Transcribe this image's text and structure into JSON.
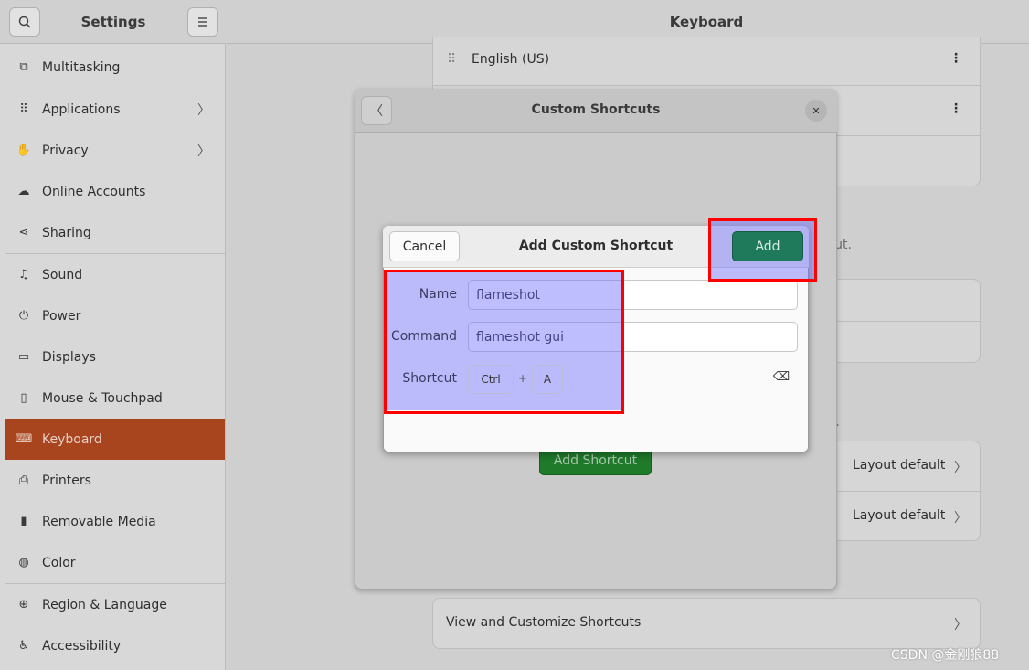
{
  "sidebar": {
    "title": "Settings",
    "search_icon": "search-icon",
    "menu_icon": "hamburger-icon",
    "items": [
      {
        "label": "Multitasking",
        "icon": "multitasking-icon",
        "glyph": "⧉"
      },
      {
        "label": "Applications",
        "icon": "apps-grid-icon",
        "glyph": "⠿",
        "chevron": "〉"
      },
      {
        "label": "Privacy",
        "icon": "hand-icon",
        "glyph": "✋",
        "chevron": "〉"
      },
      {
        "label": "Online Accounts",
        "icon": "cloud-icon",
        "glyph": "☁"
      },
      {
        "label": "Sharing",
        "icon": "share-icon",
        "glyph": "⋖"
      },
      {
        "label": "Sound",
        "icon": "music-note-icon",
        "glyph": "♫"
      },
      {
        "label": "Power",
        "icon": "power-icon",
        "glyph": "⏻"
      },
      {
        "label": "Displays",
        "icon": "display-icon",
        "glyph": "▭"
      },
      {
        "label": "Mouse & Touchpad",
        "icon": "mouse-icon",
        "glyph": "▯"
      },
      {
        "label": "Keyboard",
        "icon": "keyboard-icon",
        "glyph": "⌨"
      },
      {
        "label": "Printers",
        "icon": "printer-icon",
        "glyph": "⎙"
      },
      {
        "label": "Removable Media",
        "icon": "usb-drive-icon",
        "glyph": "▮"
      },
      {
        "label": "Color",
        "icon": "palette-icon",
        "glyph": "◍"
      },
      {
        "label": "Region & Language",
        "icon": "globe-icon",
        "glyph": "⊕"
      },
      {
        "label": "Accessibility",
        "icon": "accessibility-icon",
        "glyph": "♿"
      }
    ]
  },
  "main": {
    "title": "Keyboard",
    "input_source": "English (US)",
    "hint_1": "tcut.",
    "hint_2": "rd.",
    "layout_default_1": "Layout default",
    "layout_default_2": "Layout default",
    "view_customize": "View and Customize Shortcuts",
    "chevron": "〉",
    "more_icon": "⋮"
  },
  "custom_shortcuts": {
    "title": "Custom Shortcuts",
    "back_glyph": "〈",
    "close_glyph": "✕",
    "add_shortcut_label": "Add Shortcut"
  },
  "add_dialog": {
    "title": "Add Custom Shortcut",
    "cancel_label": "Cancel",
    "add_label": "Add",
    "name_label": "Name",
    "name_value": "flameshot",
    "command_label": "Command",
    "command_value": "flameshot gui",
    "shortcut_label": "Shortcut",
    "key_1": "Ctrl",
    "plus": "+",
    "key_2": "A",
    "clear_glyph": "⌫"
  },
  "colors": {
    "accent_active": "#a8441e",
    "add_button": "#1e7a5a",
    "add_shortcut_button": "#1f7a2a",
    "highlight_overlay": "rgba(110,110,255,0.45)",
    "annotation_red": "#ff0000"
  },
  "watermark": "CSDN @金刚狼88"
}
